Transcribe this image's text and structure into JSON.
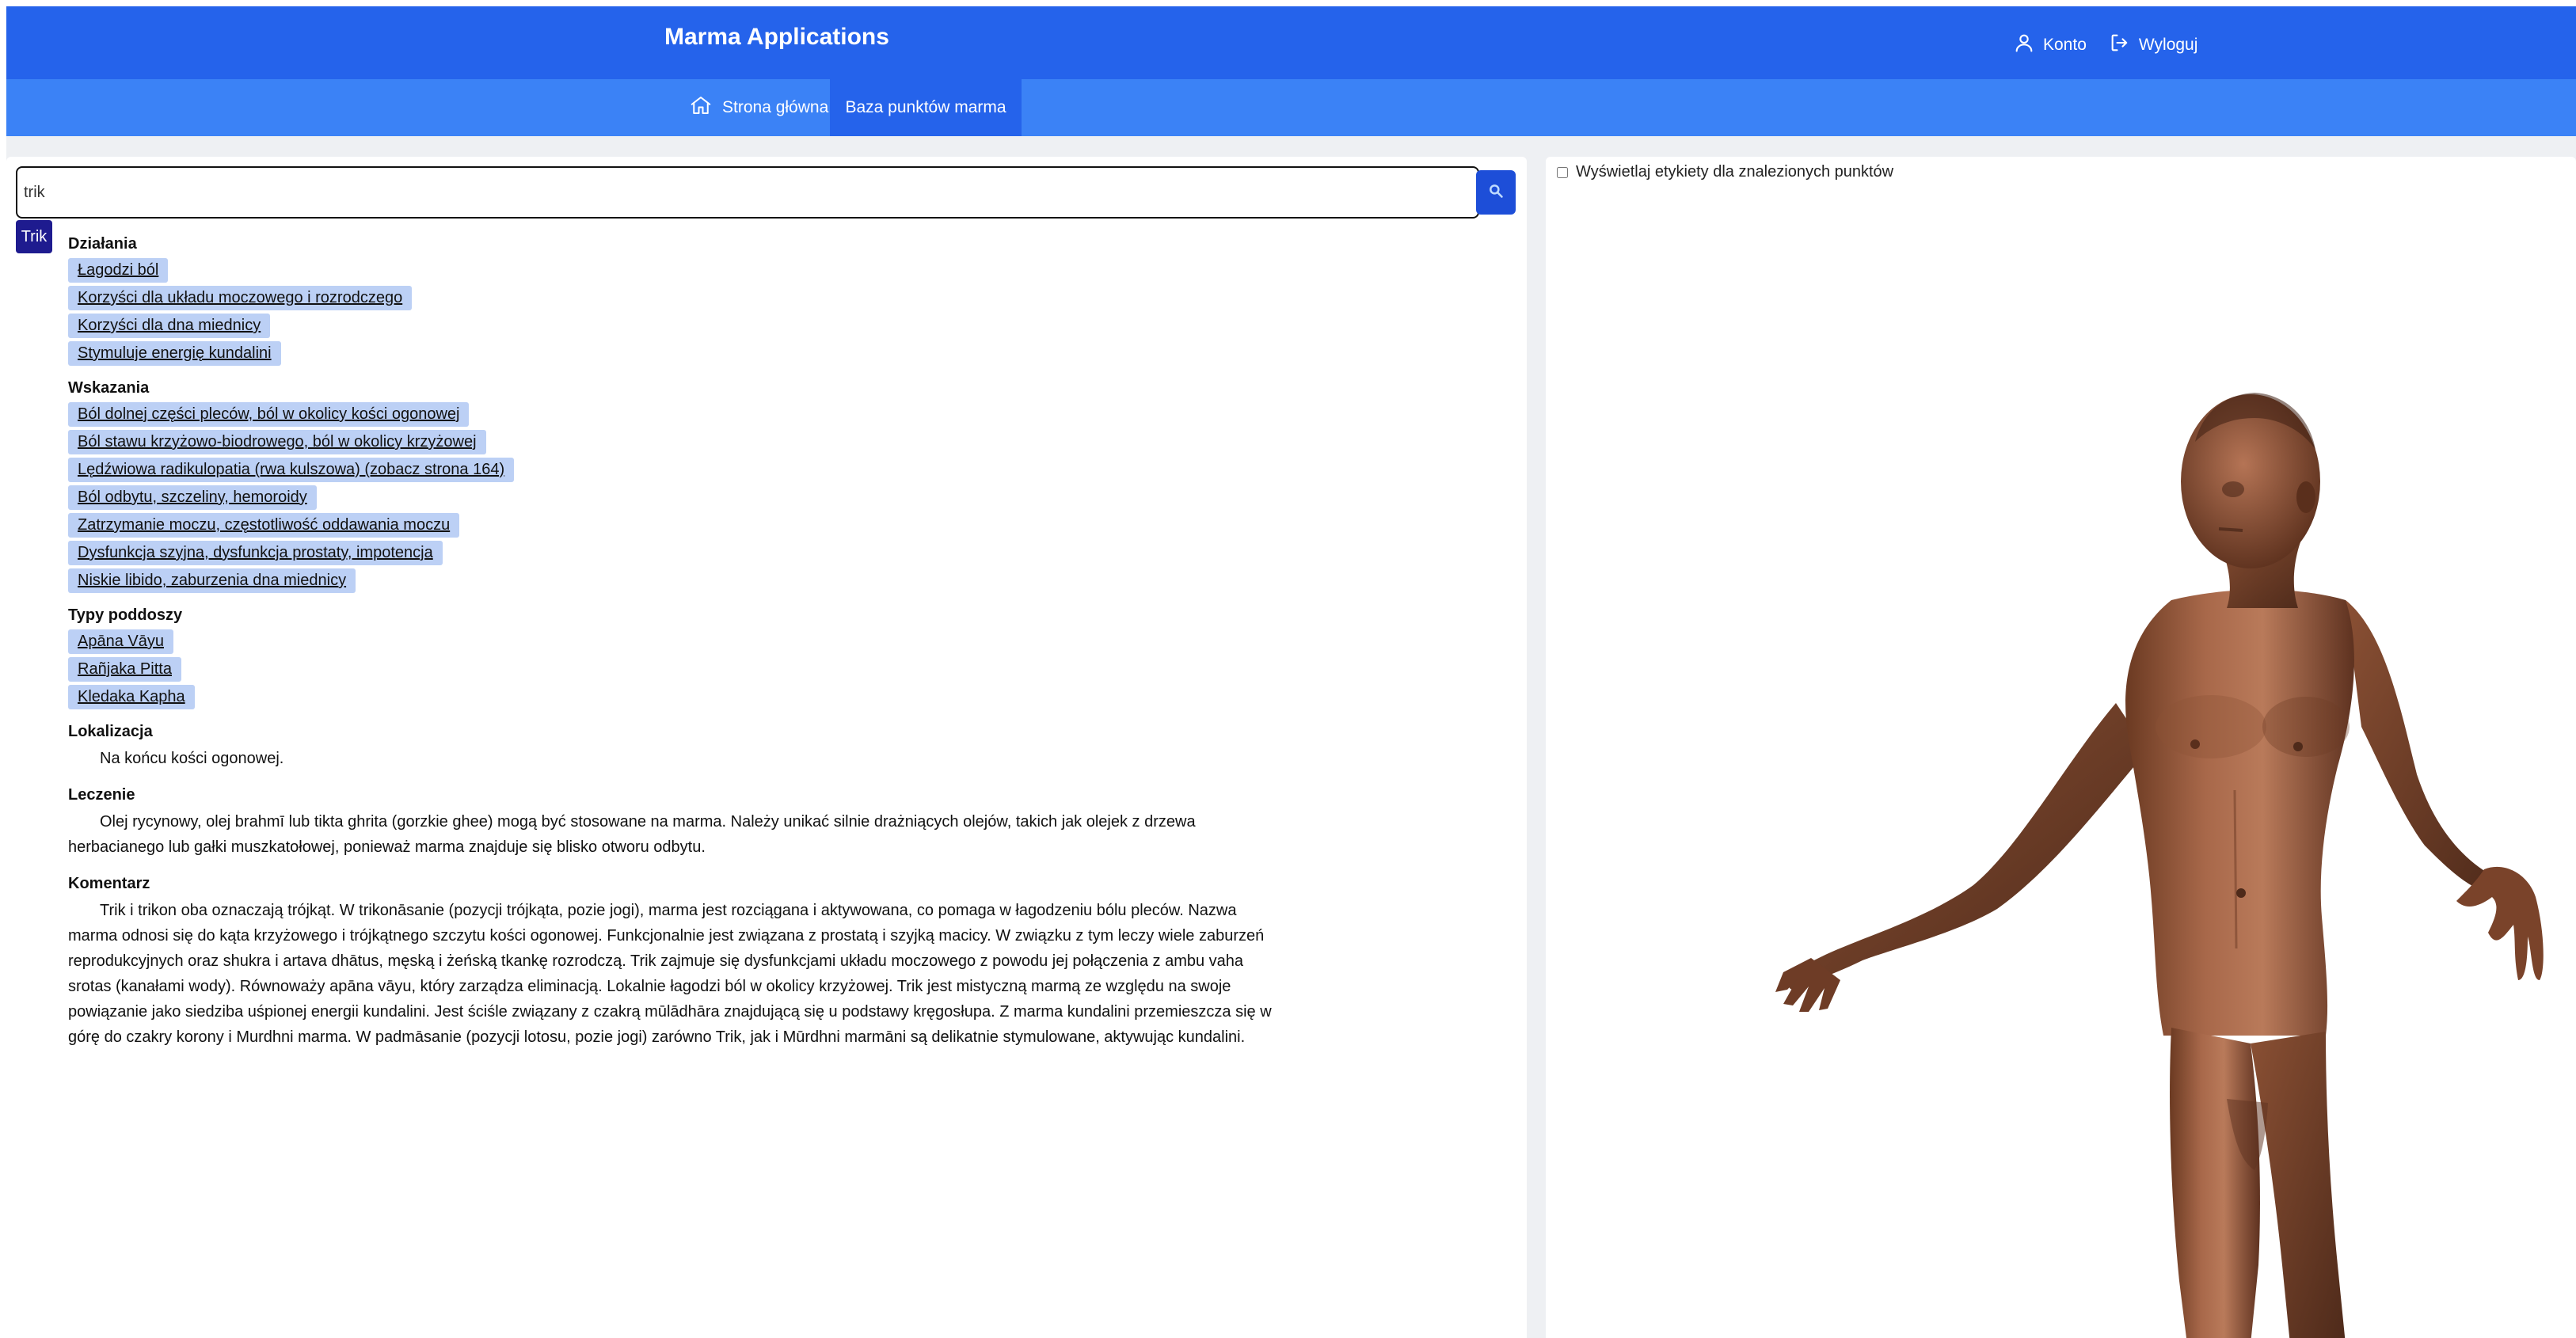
{
  "header": {
    "app_title": "Marma Applications",
    "account_label": "Konto",
    "logout_label": "Wyloguj",
    "bg_color": "#2563eb"
  },
  "nav": {
    "tabs": [
      {
        "label": "Strona główna",
        "icon": "home-icon",
        "active": false
      },
      {
        "label": "Baza punktów marma",
        "icon": "",
        "active": true
      }
    ],
    "bg_color": "#3b82f6"
  },
  "search": {
    "value": "trik",
    "button_icon": "search-icon"
  },
  "results": [
    {
      "label": "Trik",
      "selected": true
    }
  ],
  "details": {
    "actions": {
      "title": "Działania",
      "items": [
        "Łagodzi ból",
        "Korzyści dla układu moczowego i rozrodczego",
        "Korzyści dla dna miednicy",
        "Stymuluje energię kundalini"
      ]
    },
    "indications": {
      "title": "Wskazania",
      "items": [
        "Ból dolnej części pleców, ból w okolicy kości ogonowej",
        "Ból stawu krzyżowo-biodrowego, ból w okolicy krzyżowej",
        "Lędźwiowa radikulopatia (rwa kulszowa) (zobacz strona 164)",
        "Ból odbytu, szczeliny, hemoroidy",
        "Zatrzymanie moczu, częstotliwość oddawania moczu",
        "Dysfunkcja szyjna, dysfunkcja prostaty, impotencja",
        "Niskie libido, zaburzenia dna miednicy"
      ]
    },
    "subdosha": {
      "title": "Typy poddoszy",
      "items": [
        "Apāna Vāyu",
        "Rañjaka Pitta",
        "Kledaka Kapha"
      ]
    },
    "location": {
      "title": "Lokalizacja",
      "text": "Na końcu kości ogonowej."
    },
    "treatment": {
      "title": "Leczenie",
      "text": "Olej rycynowy, olej brahmī lub tikta ghrita (gorzkie ghee) mogą być stosowane na marma. Należy unikać silnie drażniących olejów, takich jak olejek z drzewa herbacianego lub gałki muszkatołowej, ponieważ marma znajduje się blisko otworu odbytu."
    },
    "comment": {
      "title": "Komentarz",
      "text": "Trik i trikon oba oznaczają trójkąt. W trikonāsanie (pozycji trójkąta, pozie jogi), marma jest rozciągana i aktywowana, co pomaga w łagodzeniu bólu pleców. Nazwa marma odnosi się do kąta krzyżowego i trójkątnego szczytu kości ogonowej. Funkcjonalnie jest związana z prostatą i szyjką macicy. W związku z tym leczy wiele zaburzeń reprodukcyjnych oraz shukra i artava dhātus, męską i żeńską tkankę rozrodczą. Trik zajmuje się dysfunkcjami układu moczowego z powodu jej połączenia z ambu vaha srotas (kanałami wody). Równoważy apāna vāyu, który zarządza eliminacją. Lokalnie łagodzi ból w okolicy krzyżowej. Trik jest mistyczną marmą ze względu na swoje powiązanie jako siedziba uśpionej energii kundalini. Jest ściśle związany z czakrą mūlādhāra znajdującą się u podstawy kręgosłupa. Z marma kundalini przemieszcza się w górę do czakry korony i Murdhni marma. W padmāsanie (pozycji lotosu, pozie jogi) zarówno Trik, jak i Mūrdhni marmāni są delikatnie stymulowane, aktywując kundalini."
    }
  },
  "viewer": {
    "show_labels_label": "Wyświetlaj etykiety dla znalezionych punktów",
    "show_labels_checked": false
  }
}
